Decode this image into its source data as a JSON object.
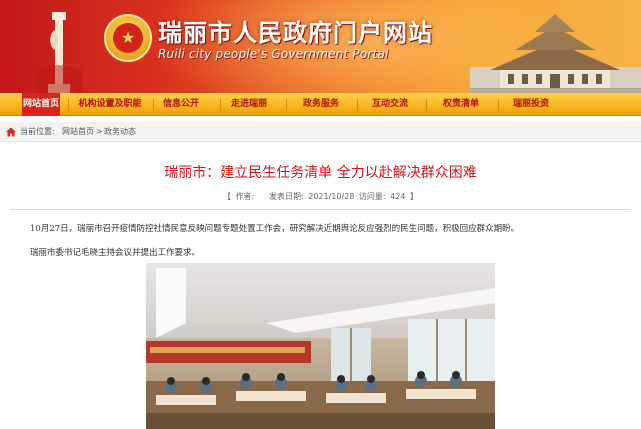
{
  "header": {
    "site_title": "瑞丽市人民政府门户网站",
    "site_subtitle": "Ruili city people's Government Portal",
    "emblem_glyph": "★"
  },
  "nav": {
    "items": [
      {
        "label": "网站首页",
        "active": true
      },
      {
        "label": "机构设置及职能",
        "active": false
      },
      {
        "label": "信息公开",
        "active": false
      },
      {
        "label": "走进瑞丽",
        "active": false
      },
      {
        "label": "政务服务",
        "active": false
      },
      {
        "label": "互动交流",
        "active": false
      },
      {
        "label": "权责清单",
        "active": false
      },
      {
        "label": "瑞丽投资",
        "active": false
      }
    ]
  },
  "breadcrumb": {
    "prefix": "当前位置:",
    "home": "网站首页",
    "separator": ">",
    "current": "政务动态"
  },
  "article": {
    "title": "瑞丽市：建立民生任务清单 全力以赴解决群众困难",
    "meta": {
      "open_bracket": "【",
      "author_label": "作者:",
      "published_label": "发表日期:",
      "published_date": "2021/10/28",
      "views_label": "访问量:",
      "views": "424",
      "close_bracket": "】"
    },
    "paragraphs": [
      "10月27日，瑞丽市召开疫情防控社情民意反映问题专题处置工作会，研究解决近期舆论反应强烈的民生问题，积极回应群众期盼。",
      "瑞丽市委书记毛晓主持会议并提出工作要求。"
    ]
  },
  "colors": {
    "brand_red": "#d9231b",
    "nav_gold": "#f7b41d",
    "title_red": "#d0161b"
  }
}
